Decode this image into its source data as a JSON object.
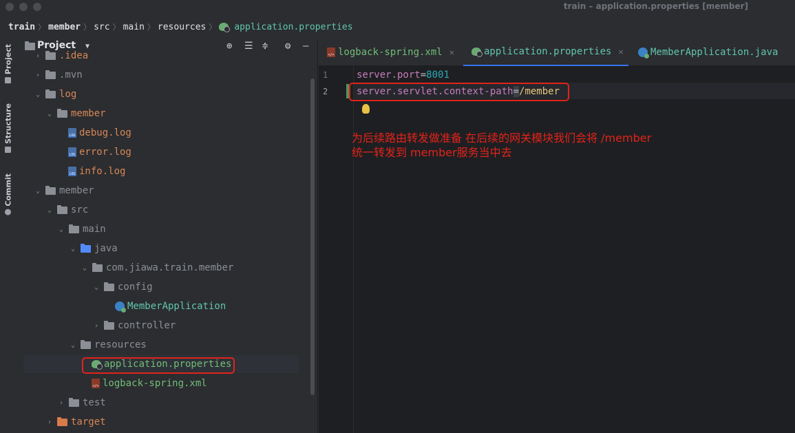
{
  "window": {
    "title": "train – application.properties [member]"
  },
  "breadcrumb": {
    "items": [
      "train",
      "member",
      "src",
      "main",
      "resources"
    ],
    "current": "application.properties"
  },
  "toolstrip": {
    "project": "Project",
    "structure": "Structure",
    "commit": "Commit"
  },
  "project_panel": {
    "title": "Project",
    "tree": [
      {
        "label": ".idea",
        "type": "folder",
        "color": "orange"
      },
      {
        "label": ".mvn",
        "type": "folder",
        "color": "gray"
      },
      {
        "label": "log",
        "type": "folder",
        "color": "orange"
      },
      {
        "label": "member",
        "type": "folder",
        "color": "orange"
      },
      {
        "label": "debug.log",
        "type": "log",
        "color": "orange"
      },
      {
        "label": "error.log",
        "type": "log",
        "color": "orange"
      },
      {
        "label": "info.log",
        "type": "log",
        "color": "orange"
      },
      {
        "label": "member",
        "type": "module",
        "color": "gray"
      },
      {
        "label": "src",
        "type": "folder",
        "color": "gray"
      },
      {
        "label": "main",
        "type": "folder",
        "color": "gray"
      },
      {
        "label": "java",
        "type": "folder",
        "color": "gray"
      },
      {
        "label": "com.jiawa.train.member",
        "type": "package",
        "color": "gray"
      },
      {
        "label": "config",
        "type": "package",
        "color": "gray"
      },
      {
        "label": "MemberApplication",
        "type": "class",
        "color": "green"
      },
      {
        "label": "controller",
        "type": "package",
        "color": "gray"
      },
      {
        "label": "resources",
        "type": "folder",
        "color": "gray"
      },
      {
        "label": "application.properties",
        "type": "spring",
        "color": "green"
      },
      {
        "label": "logback-spring.xml",
        "type": "xml",
        "color": "green"
      },
      {
        "label": "test",
        "type": "folder",
        "color": "gray"
      },
      {
        "label": "target",
        "type": "folder",
        "color": "orange"
      }
    ]
  },
  "editor": {
    "tabs": [
      {
        "label": "logback-spring.xml",
        "active": false
      },
      {
        "label": "application.properties",
        "active": true
      },
      {
        "label": "MemberApplication.java",
        "active": false
      }
    ],
    "lines": [
      {
        "num": "1",
        "key": "server.port",
        "eq": "=",
        "value": "8001"
      },
      {
        "num": "2",
        "key": "server.servlet.context-path",
        "eq": "=",
        "value": "/member"
      }
    ]
  },
  "annotation": {
    "line1": "为后续路由转发做准备 在后续的网关模块我们会将 /member",
    "line2": "统一转发到 member服务当中去"
  },
  "colors": {
    "accent": "#3574f0",
    "annotation_red": "#e2231a",
    "spring_green": "#6aab73"
  }
}
